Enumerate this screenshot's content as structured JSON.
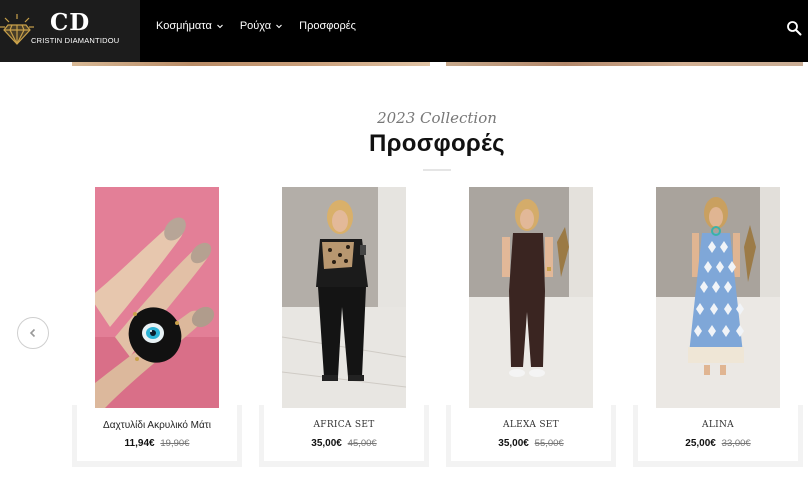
{
  "header": {
    "logo_letters": "CD",
    "logo_subtitle": "CRISTIN DIAMANTIDOU",
    "nav": [
      {
        "label": "Κοσμήματα",
        "has_dropdown": true
      },
      {
        "label": "Ρούχα",
        "has_dropdown": true
      },
      {
        "label": "Προσφορές",
        "has_dropdown": false
      }
    ],
    "search_icon": "search-icon"
  },
  "section": {
    "subtitle": "2023 Collection",
    "title": "Προσφορές"
  },
  "carousel": {
    "prev_icon": "chevron-left-icon",
    "products": [
      {
        "name": "Δαχτυλίδι Ακρυλικό Μάτι",
        "price": "11,94€",
        "old_price": "19,90€"
      },
      {
        "name": "AFRICA SET",
        "price": "35,00€",
        "old_price": "45,00€"
      },
      {
        "name": "ALEXA SET",
        "price": "35,00€",
        "old_price": "55,00€"
      },
      {
        "name": "ALINA",
        "price": "25,00€",
        "old_price": "33,00€"
      }
    ]
  },
  "colors": {
    "header_bg": "#000000",
    "logo_bg": "#1c1c1c",
    "logo_gold": "#c9a14a",
    "text_dark": "#111111",
    "text_muted": "#777777"
  }
}
